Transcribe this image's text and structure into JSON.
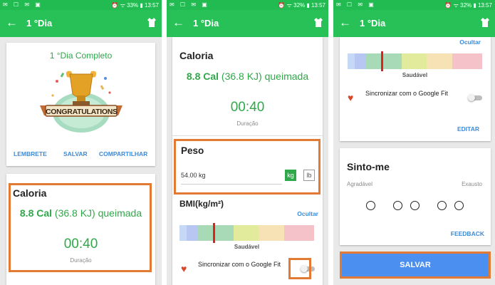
{
  "status": {
    "icons": "✉ ☐ ✉ ▣",
    "left_text": "⏰ ᯤ 33% ▮ 13:57",
    "middle_text": "⏰ ᯤ 32% ▮ 13:57",
    "right_text": "⏰ ᯤ 32% ▮ 13:57"
  },
  "appbar": {
    "back": "←",
    "title": "1 °Dia"
  },
  "screen1": {
    "complete_title": "1 °Dia Completo",
    "badge_text": "CONGRATULATIONS",
    "actions": [
      "LEMBRETE",
      "SALVAR",
      "COMPARTILHAR"
    ],
    "calorie": {
      "title": "Caloria",
      "value": "8.8 Cal",
      "kj": "(36.8 KJ) queimada",
      "time": "00:40",
      "duration": "Duração"
    }
  },
  "screen2": {
    "calorie": {
      "title": "Caloria",
      "value": "8.8 Cal",
      "kj": "(36.8 KJ) queimada",
      "time": "00:40",
      "duration": "Duração"
    },
    "weight": {
      "title": "Peso",
      "value": "54.00 kg",
      "unit_kg": "kg",
      "unit_lb": "lb"
    },
    "bmi": {
      "title": "BMI(kg/m²)",
      "hide": "Ocultar",
      "label": "Saudável",
      "level": 0.25
    },
    "sync_label": "Sincronizar com o Google Fit"
  },
  "screen3": {
    "hide": "Ocultar",
    "bmi_label": "Saudável",
    "sync_label": "Sincronizar com o Google Fit",
    "edit": "EDITAR",
    "feel": {
      "title": "Sinto-me",
      "left": "Agradável",
      "right": "Exausto",
      "feedback": "FEEDBACK"
    },
    "save": "SALVAR"
  },
  "colors": {
    "appbar": "#27c158",
    "accent_green": "#2fa84a",
    "link_blue": "#3d8ad6",
    "highlight": "#e37a33",
    "save_button": "#4b8ff0"
  }
}
